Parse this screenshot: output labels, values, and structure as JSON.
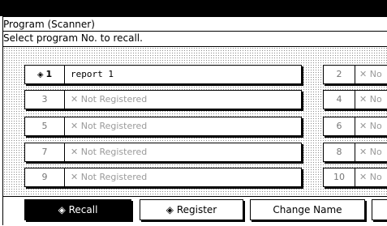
{
  "panel": {
    "title": "Program (Scanner)",
    "instruction": "Select program No. to recall."
  },
  "programs": [
    {
      "number": "1",
      "name": "report 1",
      "registered": true,
      "selected": true
    },
    {
      "number": "2",
      "name": "✕ No",
      "registered": false
    },
    {
      "number": "3",
      "name": "✕ Not Registered",
      "registered": false
    },
    {
      "number": "4",
      "name": "✕ No",
      "registered": false
    },
    {
      "number": "5",
      "name": "✕ Not Registered",
      "registered": false
    },
    {
      "number": "6",
      "name": "✕ No",
      "registered": false
    },
    {
      "number": "7",
      "name": "✕ Not Registered",
      "registered": false
    },
    {
      "number": "8",
      "name": "✕ No",
      "registered": false
    },
    {
      "number": "9",
      "name": "✕ Not Registered",
      "registered": false
    },
    {
      "number": "10",
      "name": "✕ No",
      "registered": false
    }
  ],
  "function_buttons": {
    "recall": "Recall",
    "register": "Register",
    "change_name": "Change Name"
  },
  "icons": {
    "selected": "diamond-arrow-icon"
  }
}
